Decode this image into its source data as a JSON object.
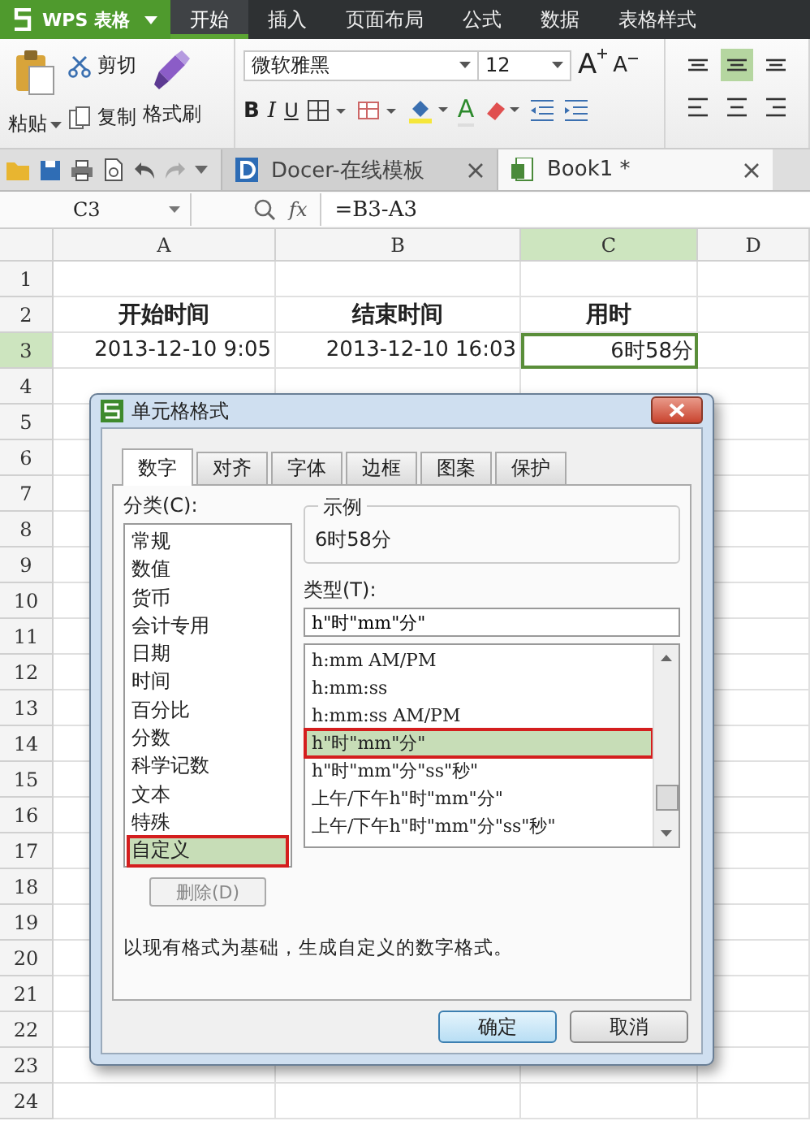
{
  "app_menu": {
    "label": "WPS 表格"
  },
  "ribbon_tabs": [
    {
      "label": "开始",
      "selected": true
    },
    {
      "label": "插入",
      "selected": false
    },
    {
      "label": "页面布局",
      "selected": false
    },
    {
      "label": "公式",
      "selected": false
    },
    {
      "label": "数据",
      "selected": false
    },
    {
      "label": "表格样式",
      "selected": false
    }
  ],
  "clipboard": {
    "paste": "粘贴",
    "cut": "剪切",
    "copy": "复制",
    "format_painter": "格式刷"
  },
  "font": {
    "name": "微软雅黑",
    "size": "12",
    "grow": "A",
    "shrink": "A",
    "bold": "B",
    "italic": "I",
    "underline": "U",
    "font_color": "A"
  },
  "align_buttons": [
    {
      "kind": "top",
      "selected": false
    },
    {
      "kind": "middle",
      "selected": true
    },
    {
      "kind": "bottom",
      "selected": false
    },
    {
      "kind": "left",
      "selected": false
    },
    {
      "kind": "center",
      "selected": false
    },
    {
      "kind": "right",
      "selected": false
    }
  ],
  "doc_tabs": [
    {
      "label": "Docer-在线模板",
      "selected": false
    },
    {
      "label": "Book1 *",
      "selected": true
    }
  ],
  "formula_bar": {
    "name_box": "C3",
    "fx": "fx",
    "formula": "=B3-A3"
  },
  "sheet": {
    "columns": [
      {
        "label": "A",
        "selected": false
      },
      {
        "label": "B",
        "selected": false
      },
      {
        "label": "C",
        "selected": true
      },
      {
        "label": "D",
        "selected": false
      }
    ],
    "rows": [
      {
        "label": "1",
        "selected": false
      },
      {
        "label": "2",
        "selected": false,
        "cells": [
          {
            "text": "开始时间",
            "kind": "header",
            "selected": false
          },
          {
            "text": "结束时间",
            "kind": "header",
            "selected": false
          },
          {
            "text": "用时",
            "kind": "header",
            "selected": false
          }
        ]
      },
      {
        "label": "3",
        "selected": true,
        "cells": [
          {
            "text": "2013-12-10 9:05",
            "kind": "value",
            "selected": false
          },
          {
            "text": "2013-12-10 16:03",
            "kind": "value",
            "selected": false
          },
          {
            "text": "6时58分",
            "kind": "value",
            "selected": true
          }
        ]
      },
      {
        "label": "4",
        "selected": false
      },
      {
        "label": "5",
        "selected": false
      },
      {
        "label": "6",
        "selected": false
      },
      {
        "label": "7",
        "selected": false
      },
      {
        "label": "8",
        "selected": false
      },
      {
        "label": "9",
        "selected": false
      },
      {
        "label": "10",
        "selected": false
      },
      {
        "label": "11",
        "selected": false
      },
      {
        "label": "12",
        "selected": false
      },
      {
        "label": "13",
        "selected": false
      },
      {
        "label": "14",
        "selected": false
      },
      {
        "label": "15",
        "selected": false
      },
      {
        "label": "16",
        "selected": false
      },
      {
        "label": "17",
        "selected": false
      },
      {
        "label": "18",
        "selected": false
      },
      {
        "label": "19",
        "selected": false
      },
      {
        "label": "20",
        "selected": false
      },
      {
        "label": "21",
        "selected": false
      },
      {
        "label": "22",
        "selected": false
      },
      {
        "label": "23",
        "selected": false
      },
      {
        "label": "24",
        "selected": false
      }
    ]
  },
  "dialog": {
    "title": "单元格格式",
    "tabs": [
      {
        "label": "数字",
        "selected": true
      },
      {
        "label": "对齐",
        "selected": false
      },
      {
        "label": "字体",
        "selected": false
      },
      {
        "label": "边框",
        "selected": false
      },
      {
        "label": "图案",
        "selected": false
      },
      {
        "label": "保护",
        "selected": false
      }
    ],
    "category_label": "分类(C):",
    "categories": [
      {
        "label": "常规",
        "selected": false,
        "highlighted": false
      },
      {
        "label": "数值",
        "selected": false,
        "highlighted": false
      },
      {
        "label": "货币",
        "selected": false,
        "highlighted": false
      },
      {
        "label": "会计专用",
        "selected": false,
        "highlighted": false
      },
      {
        "label": "日期",
        "selected": false,
        "highlighted": false
      },
      {
        "label": "时间",
        "selected": false,
        "highlighted": false
      },
      {
        "label": "百分比",
        "selected": false,
        "highlighted": false
      },
      {
        "label": "分数",
        "selected": false,
        "highlighted": false
      },
      {
        "label": "科学记数",
        "selected": false,
        "highlighted": false
      },
      {
        "label": "文本",
        "selected": false,
        "highlighted": false
      },
      {
        "label": "特殊",
        "selected": false,
        "highlighted": false
      },
      {
        "label": "自定义",
        "selected": true,
        "highlighted": true
      }
    ],
    "delete_button": {
      "label": "删除(D)",
      "disabled": true
    },
    "sample_label": "示例",
    "sample_value": "6时58分",
    "type_label": "类型(T):",
    "type_value": "h\"时\"mm\"分\"",
    "types": [
      {
        "label": "h:mm AM/PM",
        "selected": false,
        "highlighted": false
      },
      {
        "label": "h:mm:ss",
        "selected": false,
        "highlighted": false
      },
      {
        "label": "h:mm:ss AM/PM",
        "selected": false,
        "highlighted": false
      },
      {
        "label": "h\"时\"mm\"分\"",
        "selected": true,
        "highlighted": true
      },
      {
        "label": "h\"时\"mm\"分\"ss\"秒\"",
        "selected": false,
        "highlighted": false
      },
      {
        "label": "上午/下午h\"时\"mm\"分\"",
        "selected": false,
        "highlighted": false
      },
      {
        "label": "上午/下午h\"时\"mm\"分\"ss\"秒\"",
        "selected": false,
        "highlighted": false
      }
    ],
    "description": "以现有格式为基础，生成自定义的数字格式。",
    "buttons": [
      {
        "label": "确定",
        "default": true
      },
      {
        "label": "取消",
        "default": false
      }
    ]
  }
}
